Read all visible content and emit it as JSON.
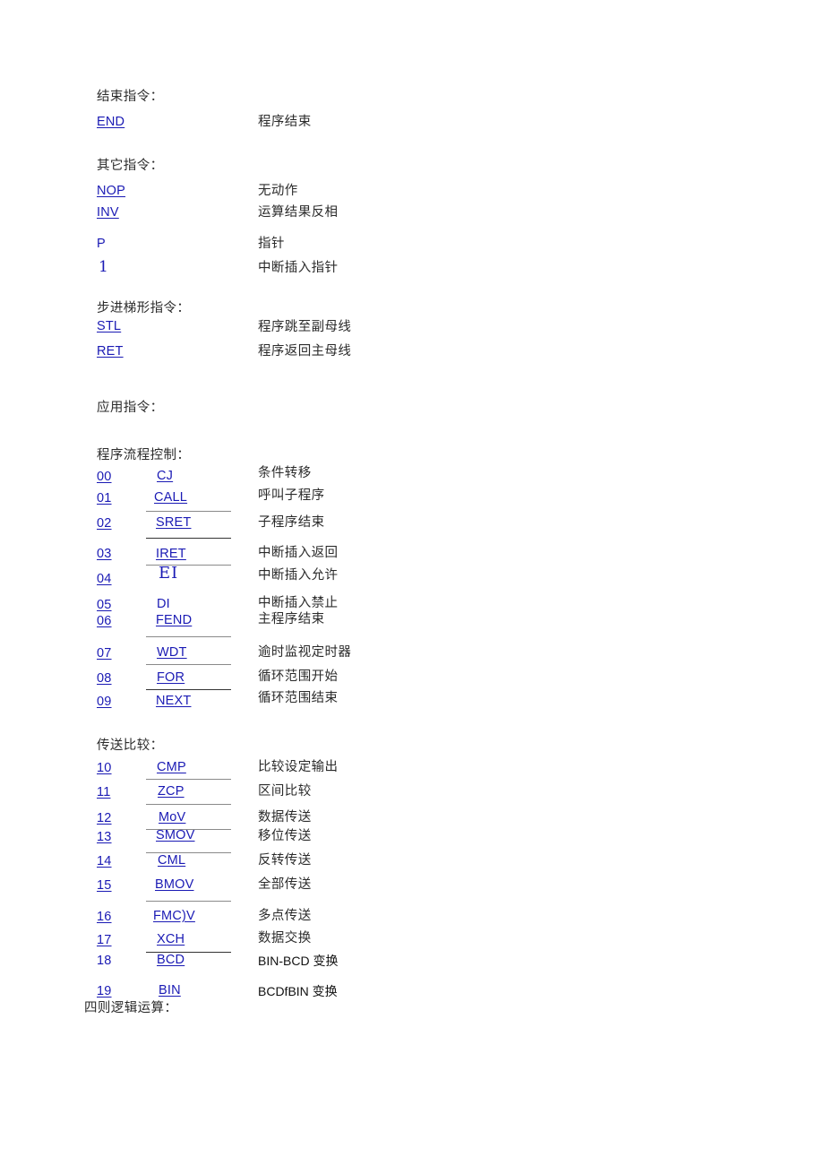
{
  "document": {
    "title": "PLC 指令索引",
    "link_color": "#1a1ab4",
    "text_color": "#2b2b2b"
  },
  "sections": [
    {
      "id": "end-instructions",
      "heading": "结束指令：",
      "rows": [
        {
          "num": "",
          "mnemonic": "END",
          "desc": "程序结束"
        }
      ]
    },
    {
      "id": "other-instructions",
      "heading": "其它指令：",
      "rows": [
        {
          "num": "",
          "mnemonic": "NOP",
          "desc": "无动作"
        },
        {
          "num": "",
          "mnemonic": "INV",
          "desc": "运算结果反相"
        },
        {
          "num": "",
          "mnemonic": "P",
          "desc": "指针"
        },
        {
          "num": "",
          "mnemonic": "1",
          "desc": "中断插入指针"
        }
      ]
    },
    {
      "id": "step-ladder-instructions",
      "heading": "步进梯形指令：",
      "rows": [
        {
          "num": "",
          "mnemonic": "STL",
          "desc": "程序跳至副母线"
        },
        {
          "num": "",
          "mnemonic": "RET",
          "desc": "程序返回主母线"
        }
      ]
    },
    {
      "id": "application-instructions",
      "heading": "应用指令：",
      "rows": []
    },
    {
      "id": "program-flow-control",
      "heading": "程序流程控制：",
      "rows": [
        {
          "num": "00",
          "mnemonic": "CJ",
          "desc": "条件转移"
        },
        {
          "num": "01",
          "mnemonic": "CALL",
          "desc": "呼叫子程序"
        },
        {
          "num": "02",
          "mnemonic": "SRET",
          "desc": "子程序结束"
        },
        {
          "num": "03",
          "mnemonic": "IRET",
          "desc": "中断插入返回"
        },
        {
          "num": "04",
          "mnemonic": "EI",
          "desc": "中断插入允许"
        },
        {
          "num": "05",
          "mnemonic": "DI",
          "desc": "中断插入禁止"
        },
        {
          "num": "06",
          "mnemonic": "FEND",
          "desc": "主程序结束"
        },
        {
          "num": "07",
          "mnemonic": "WDT",
          "desc": "逾时监视定时器"
        },
        {
          "num": "08",
          "mnemonic": "FOR",
          "desc": "循环范围开始"
        },
        {
          "num": "09",
          "mnemonic": "NEXT",
          "desc": "循环范围结束"
        }
      ]
    },
    {
      "id": "transfer-compare",
      "heading": "传送比较：",
      "rows": [
        {
          "num": "10",
          "mnemonic": "CMP",
          "desc": "比较设定输出"
        },
        {
          "num": "11",
          "mnemonic": "ZCP",
          "desc": "区间比较"
        },
        {
          "num": "12",
          "mnemonic": "MoV",
          "desc": "数据传送"
        },
        {
          "num": "13",
          "mnemonic": "SMOV",
          "desc": "移位传送"
        },
        {
          "num": "14",
          "mnemonic": "CML",
          "desc": "反转传送"
        },
        {
          "num": "15",
          "mnemonic": "BMOV",
          "desc": "全部传送"
        },
        {
          "num": "16",
          "mnemonic": "FMC)V",
          "desc": "多点传送"
        },
        {
          "num": "17",
          "mnemonic": "XCH",
          "desc": "数据交换"
        },
        {
          "num": "18",
          "mnemonic": "BCD",
          "desc": "BIN-BCD 变换"
        },
        {
          "num": "19",
          "mnemonic": "BIN",
          "desc": "BCDfBIN 变换"
        }
      ]
    },
    {
      "id": "arithmetic-logic",
      "heading": "四则逻辑运算：",
      "rows": []
    }
  ]
}
